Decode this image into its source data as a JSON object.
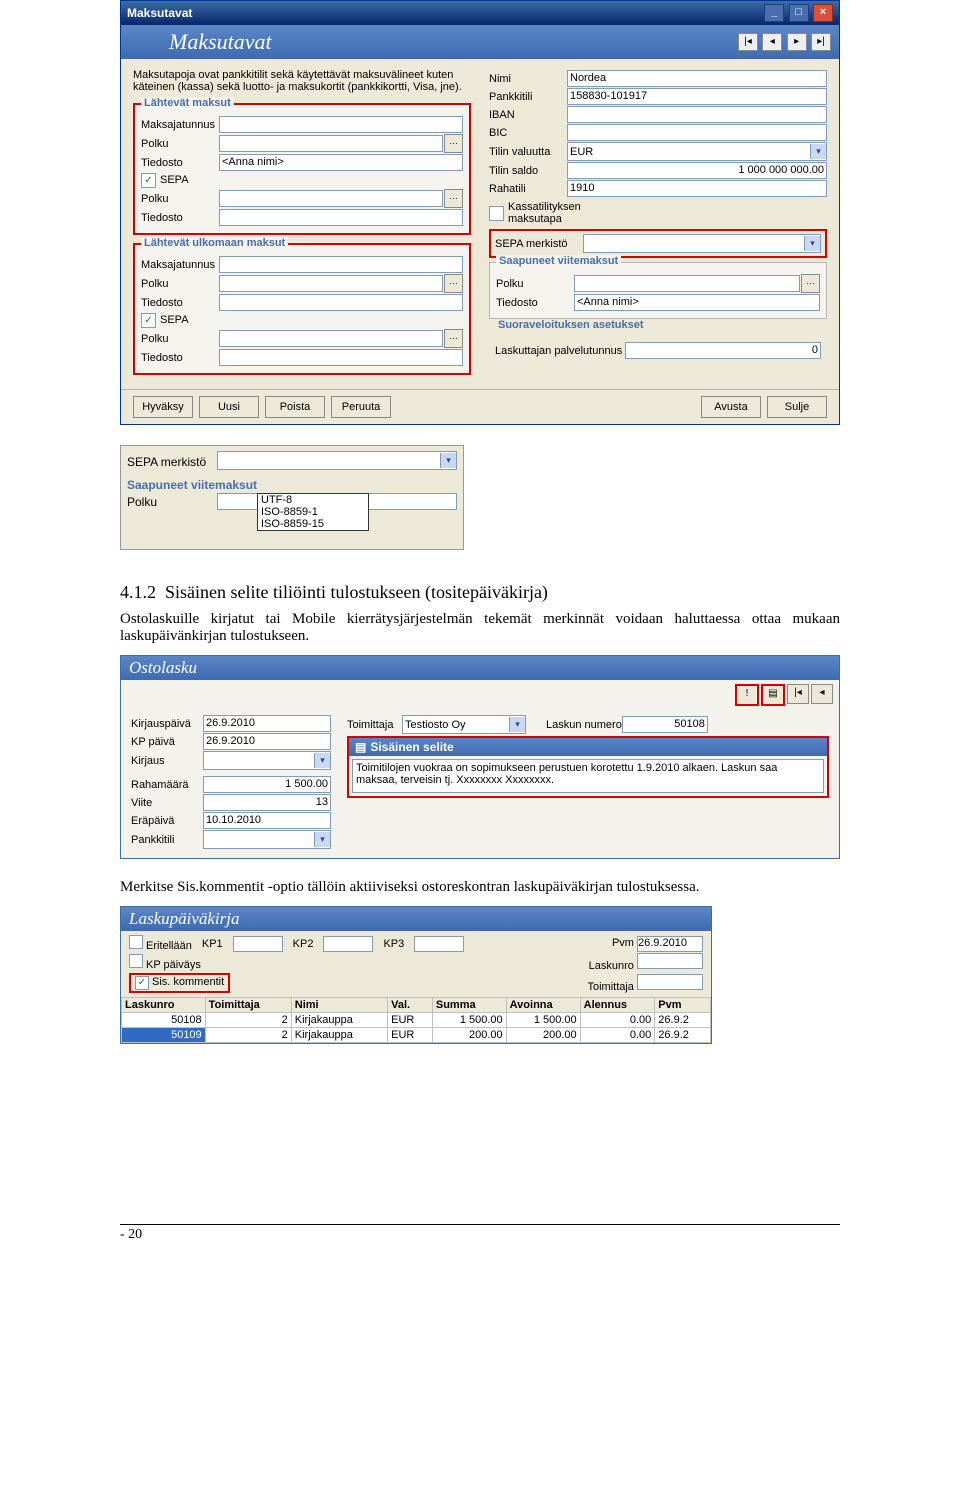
{
  "win": {
    "title": "Maksutavat",
    "heading": "Maksutavat",
    "intro": "Maksutapoja ovat pankkitilit sekä käytettävät maksuvälineet kuten käteinen (kassa) sekä luotto- ja maksukortit (pankkikortti, Visa, jne).",
    "grp1": {
      "title": "Lähtevät maksut",
      "maksajatunnus_lbl": "Maksajatunnus",
      "polku_lbl": "Polku",
      "tiedosto_lbl": "Tiedosto",
      "tiedosto_val": "<Anna nimi>",
      "sepa_lbl": "SEPA",
      "polku2_lbl": "Polku",
      "tiedosto2_lbl": "Tiedosto"
    },
    "grp2": {
      "title": "Lähtevät ulkomaan maksut",
      "maksajatunnus_lbl": "Maksajatunnus",
      "polku_lbl": "Polku",
      "tiedosto_lbl": "Tiedosto",
      "sepa_lbl": "SEPA",
      "polku2_lbl": "Polku",
      "tiedosto2_lbl": "Tiedosto"
    },
    "right": {
      "nimi_lbl": "Nimi",
      "nimi_val": "Nordea",
      "pankkitili_lbl": "Pankkitili",
      "pankkitili_val": "158830-101917",
      "iban_lbl": "IBAN",
      "bic_lbl": "BIC",
      "valuutta_lbl": "Tilin valuutta",
      "valuutta_val": "EUR",
      "saldo_lbl": "Tilin saldo",
      "saldo_val": "1 000 000 000.00",
      "rahatili_lbl": "Rahatili",
      "rahatili_val": "1910",
      "kassa_lbl": "Kassatilityksen maksutapa",
      "sepa_merkisto_lbl": "SEPA merkistö",
      "saapuneet_title": "Saapuneet viitemaksut",
      "polku_lbl": "Polku",
      "tiedosto_lbl": "Tiedosto",
      "tiedosto_val": "<Anna nimi>",
      "suora_title": "Suoraveloituksen asetukset",
      "laskuttaja_lbl": "Laskuttajan palvelutunnus",
      "laskuttaja_val": "0"
    },
    "buttons": {
      "hyvaksy": "Hyväksy",
      "uusi": "Uusi",
      "poista": "Poista",
      "peruuta": "Peruuta",
      "avusta": "Avusta",
      "sulje": "Sulje"
    }
  },
  "snip": {
    "sepa_lbl": "SEPA merkistö",
    "saap_title": "Saapuneet viitemaksut",
    "polku_lbl": "Polku",
    "opts": [
      "UTF-8",
      "ISO-8859-1",
      "ISO-8859-15"
    ]
  },
  "sec": {
    "num": "4.1.2",
    "title": "Sisäinen selite tiliöinti tulostukseen (tositepäiväkirja)",
    "p1": "Ostolaskuille kirjatut tai Mobile kierrätysjärjestelmän tekemät merkinnät voidaan haluttaessa ottaa mukaan laskupäivänkirjan tulostukseen.",
    "p2": "Merkitse Sis.kommentit -optio tällöin aktiiviseksi ostoreskontran laskupäiväkirjan tulostuksessa."
  },
  "ost": {
    "title": "Ostolasku",
    "kp_lbl": "Kirjauspäivä",
    "kp_val": "26.9.2010",
    "kpp_lbl": "KP päivä",
    "kpp_val": "26.9.2010",
    "kirjaus_lbl": "Kirjaus",
    "raha_lbl": "Rahamäärä",
    "raha_val": "1 500.00",
    "viite_lbl": "Viite",
    "viite_val": "13",
    "era_lbl": "Eräpäivä",
    "era_val": "10.10.2010",
    "pankki_lbl": "Pankkitili",
    "toimittaja_lbl": "Toimittaja",
    "toimittaja_val": "Testiosto Oy",
    "laskun_lbl": "Laskun numero",
    "laskun_val": "50108",
    "sis_title": "Sisäinen selite",
    "sis_text": "Toimitilojen vuokraa on sopimukseen perustuen korotettu 1.9.2010 alkaen. Laskun saa maksaa, terveisin tj. Xxxxxxxx Xxxxxxxx."
  },
  "lpk": {
    "title": "Laskupäiväkirja",
    "eritellaan": "Eritellään",
    "kp": "KP päiväys",
    "sis": "Sis. kommentit",
    "kp1": "KP1",
    "kp2": "KP2",
    "kp3": "KP3",
    "pvm_lbl": "Pvm",
    "pvm_val": "26.9.2010",
    "laskunro_lbl": "Laskunro",
    "toimittaja_lbl": "Toimittaja",
    "hdr": [
      "Laskunro",
      "Toimittaja",
      "Nimi",
      "Val.",
      "Summa",
      "Avoinna",
      "Alennus",
      "Pvm"
    ],
    "rows": [
      {
        "nro": "50108",
        "t": "2",
        "nimi": "Kirjakauppa",
        "val": "EUR",
        "sum": "1 500.00",
        "av": "1 500.00",
        "al": "0.00",
        "pvm": "26.9.2"
      },
      {
        "nro": "50109",
        "t": "2",
        "nimi": "Kirjakauppa",
        "val": "EUR",
        "sum": "200.00",
        "av": "200.00",
        "al": "0.00",
        "pvm": "26.9.2"
      }
    ]
  },
  "footer": "- 20"
}
